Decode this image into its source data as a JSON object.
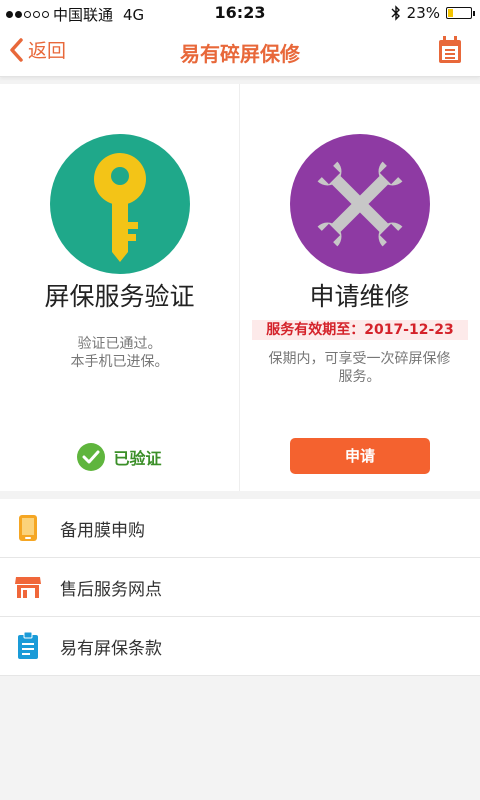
{
  "status_bar": {
    "carrier": "中国联通",
    "network": "4G",
    "time": "16:23",
    "battery": "23%",
    "battery_level": 0.23
  },
  "nav": {
    "back_label": "返回",
    "title": "易有碎屏保修",
    "right_icon": "calendar-icon"
  },
  "colors": {
    "accent": "#e8683a",
    "key_circle": "#1fa88a",
    "wrench_circle": "#8e3aa3",
    "apply_button": "#f4622f",
    "verified": "#5fb53d"
  },
  "cards": {
    "verify": {
      "title": "屏保服务验证",
      "desc_line1": "验证已通过。",
      "desc_line2": "本手机已进保。",
      "status": "已验证",
      "icon": "key-icon"
    },
    "repair": {
      "title": "申请维修",
      "expiry": "服务有效期至：2017-12-23",
      "desc_line1": "保期内，可享受一次碎屏保修",
      "desc_line2": "服务。",
      "button": "申请",
      "icon": "wrench-icon"
    }
  },
  "menu": [
    {
      "label": "备用膜申购",
      "icon": "phone-icon"
    },
    {
      "label": "售后服务网点",
      "icon": "store-icon"
    },
    {
      "label": "易有屏保条款",
      "icon": "clipboard-icon"
    }
  ]
}
